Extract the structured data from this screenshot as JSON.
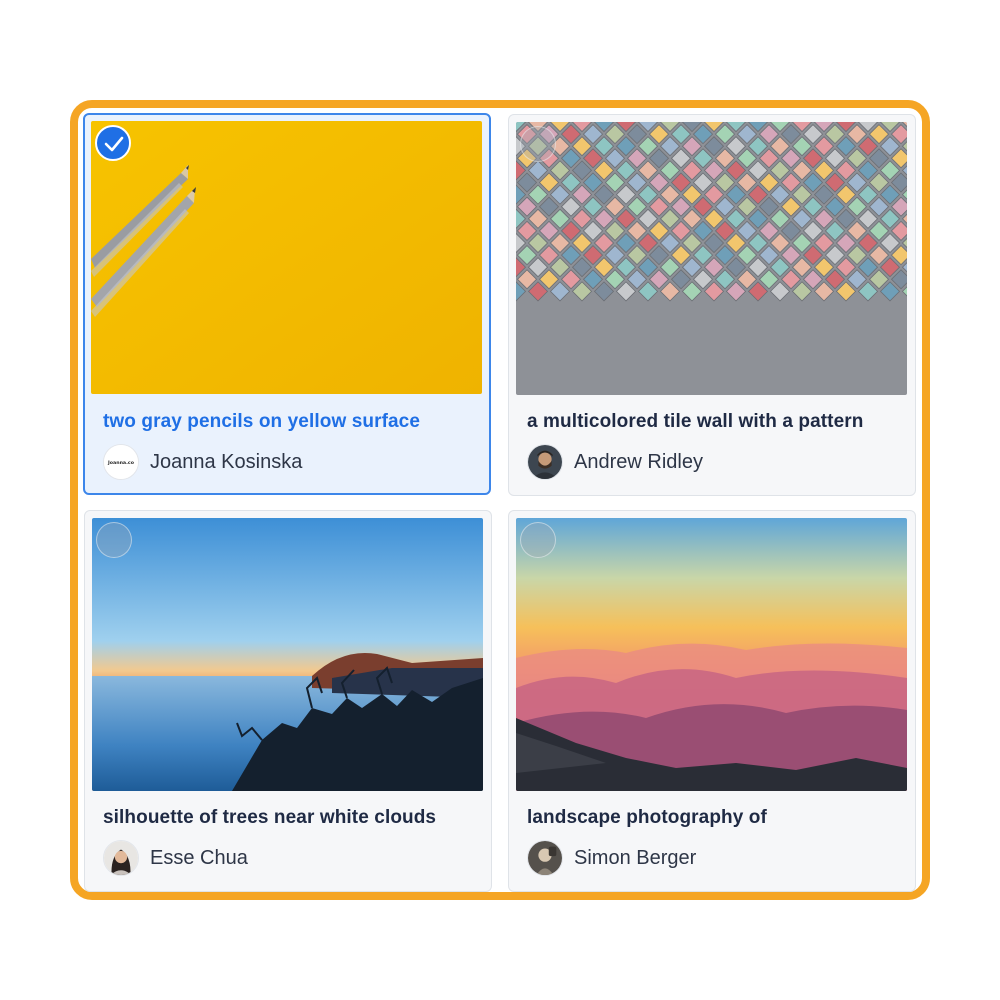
{
  "photos": [
    {
      "title": "two gray pencils on yellow surface",
      "author": "Joanna Kosinska",
      "avatar_text": "Joanna.co",
      "selected": true,
      "avatar_icon": "logo-avatar",
      "image_icon": "yellow-pencils-image"
    },
    {
      "title": "a multicolored tile wall with a pattern",
      "author": "Andrew Ridley",
      "selected": false,
      "avatar_icon": "person-avatar",
      "image_icon": "tile-wall-image"
    },
    {
      "title": "silhouette of trees near white clouds",
      "author": "Esse Chua",
      "selected": false,
      "avatar_icon": "person-avatar",
      "image_icon": "trees-clouds-image"
    },
    {
      "title": "landscape photography of",
      "author": "Simon Berger",
      "selected": false,
      "avatar_icon": "person-avatar",
      "image_icon": "mountain-sunset-image"
    }
  ],
  "colors": {
    "frame_border": "#f5a524",
    "selected_accent": "#1f6fe5",
    "title_text": "#1f2a44"
  }
}
